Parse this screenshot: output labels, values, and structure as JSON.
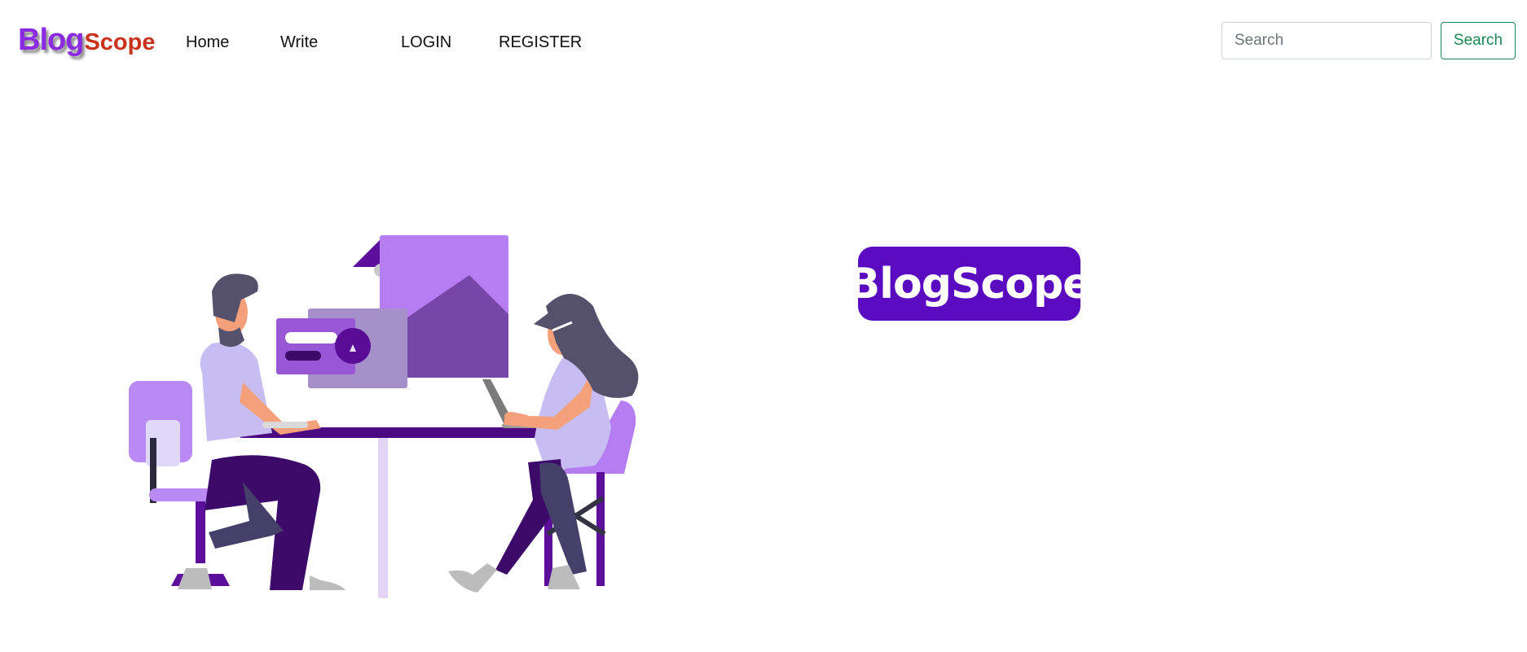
{
  "brand": {
    "part1": "Blog",
    "part2": "Scope"
  },
  "nav": {
    "home": "Home",
    "write": "Write",
    "login": "LOGIN",
    "register": "REGISTER"
  },
  "search": {
    "placeholder": "Search",
    "button_label": "Search"
  },
  "hero": {
    "logo_text": "BlogScope",
    "illustration_icon": "two-people-working-at-desk-illustration"
  },
  "colors": {
    "brand_purple": "#8a2be2",
    "brand_red": "#c9331e",
    "logo_bg": "#5a0bbf",
    "search_button": "#198754"
  }
}
